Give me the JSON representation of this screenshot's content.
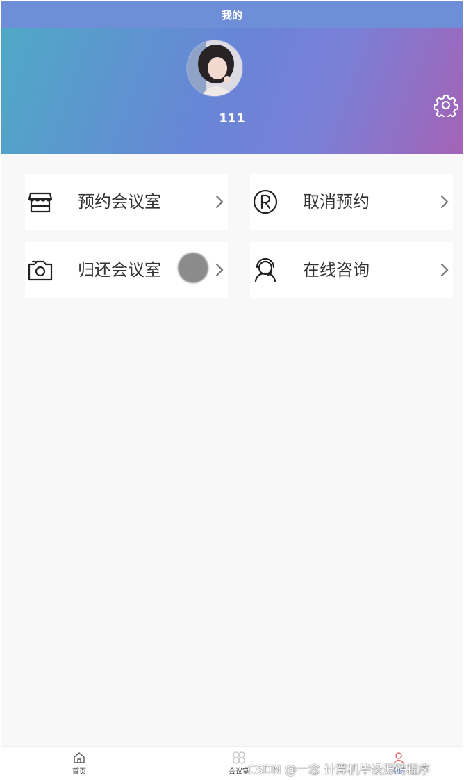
{
  "nav": {
    "title": "我的"
  },
  "profile": {
    "username": "111"
  },
  "menu": [
    {
      "label": "预约会议室",
      "icon": "shop-icon"
    },
    {
      "label": "取消预约",
      "icon": "registered-icon"
    },
    {
      "label": "归还会议室",
      "icon": "camera-icon"
    },
    {
      "label": "在线咨询",
      "icon": "headset-icon"
    }
  ],
  "tabbar": [
    {
      "label": "首页",
      "icon": "home-icon",
      "active": false
    },
    {
      "label": "会议室",
      "icon": "clover-icon",
      "active": false
    },
    {
      "label": "我的",
      "icon": "user-icon",
      "active": true
    }
  ],
  "watermark": "CSDN @一念 计算机毕设源码程序",
  "colors": {
    "nav": "#6e8ed8",
    "gradient_start": "#4fa9c6",
    "gradient_end": "#a463b6",
    "active_tab": "#5e8ad8"
  }
}
